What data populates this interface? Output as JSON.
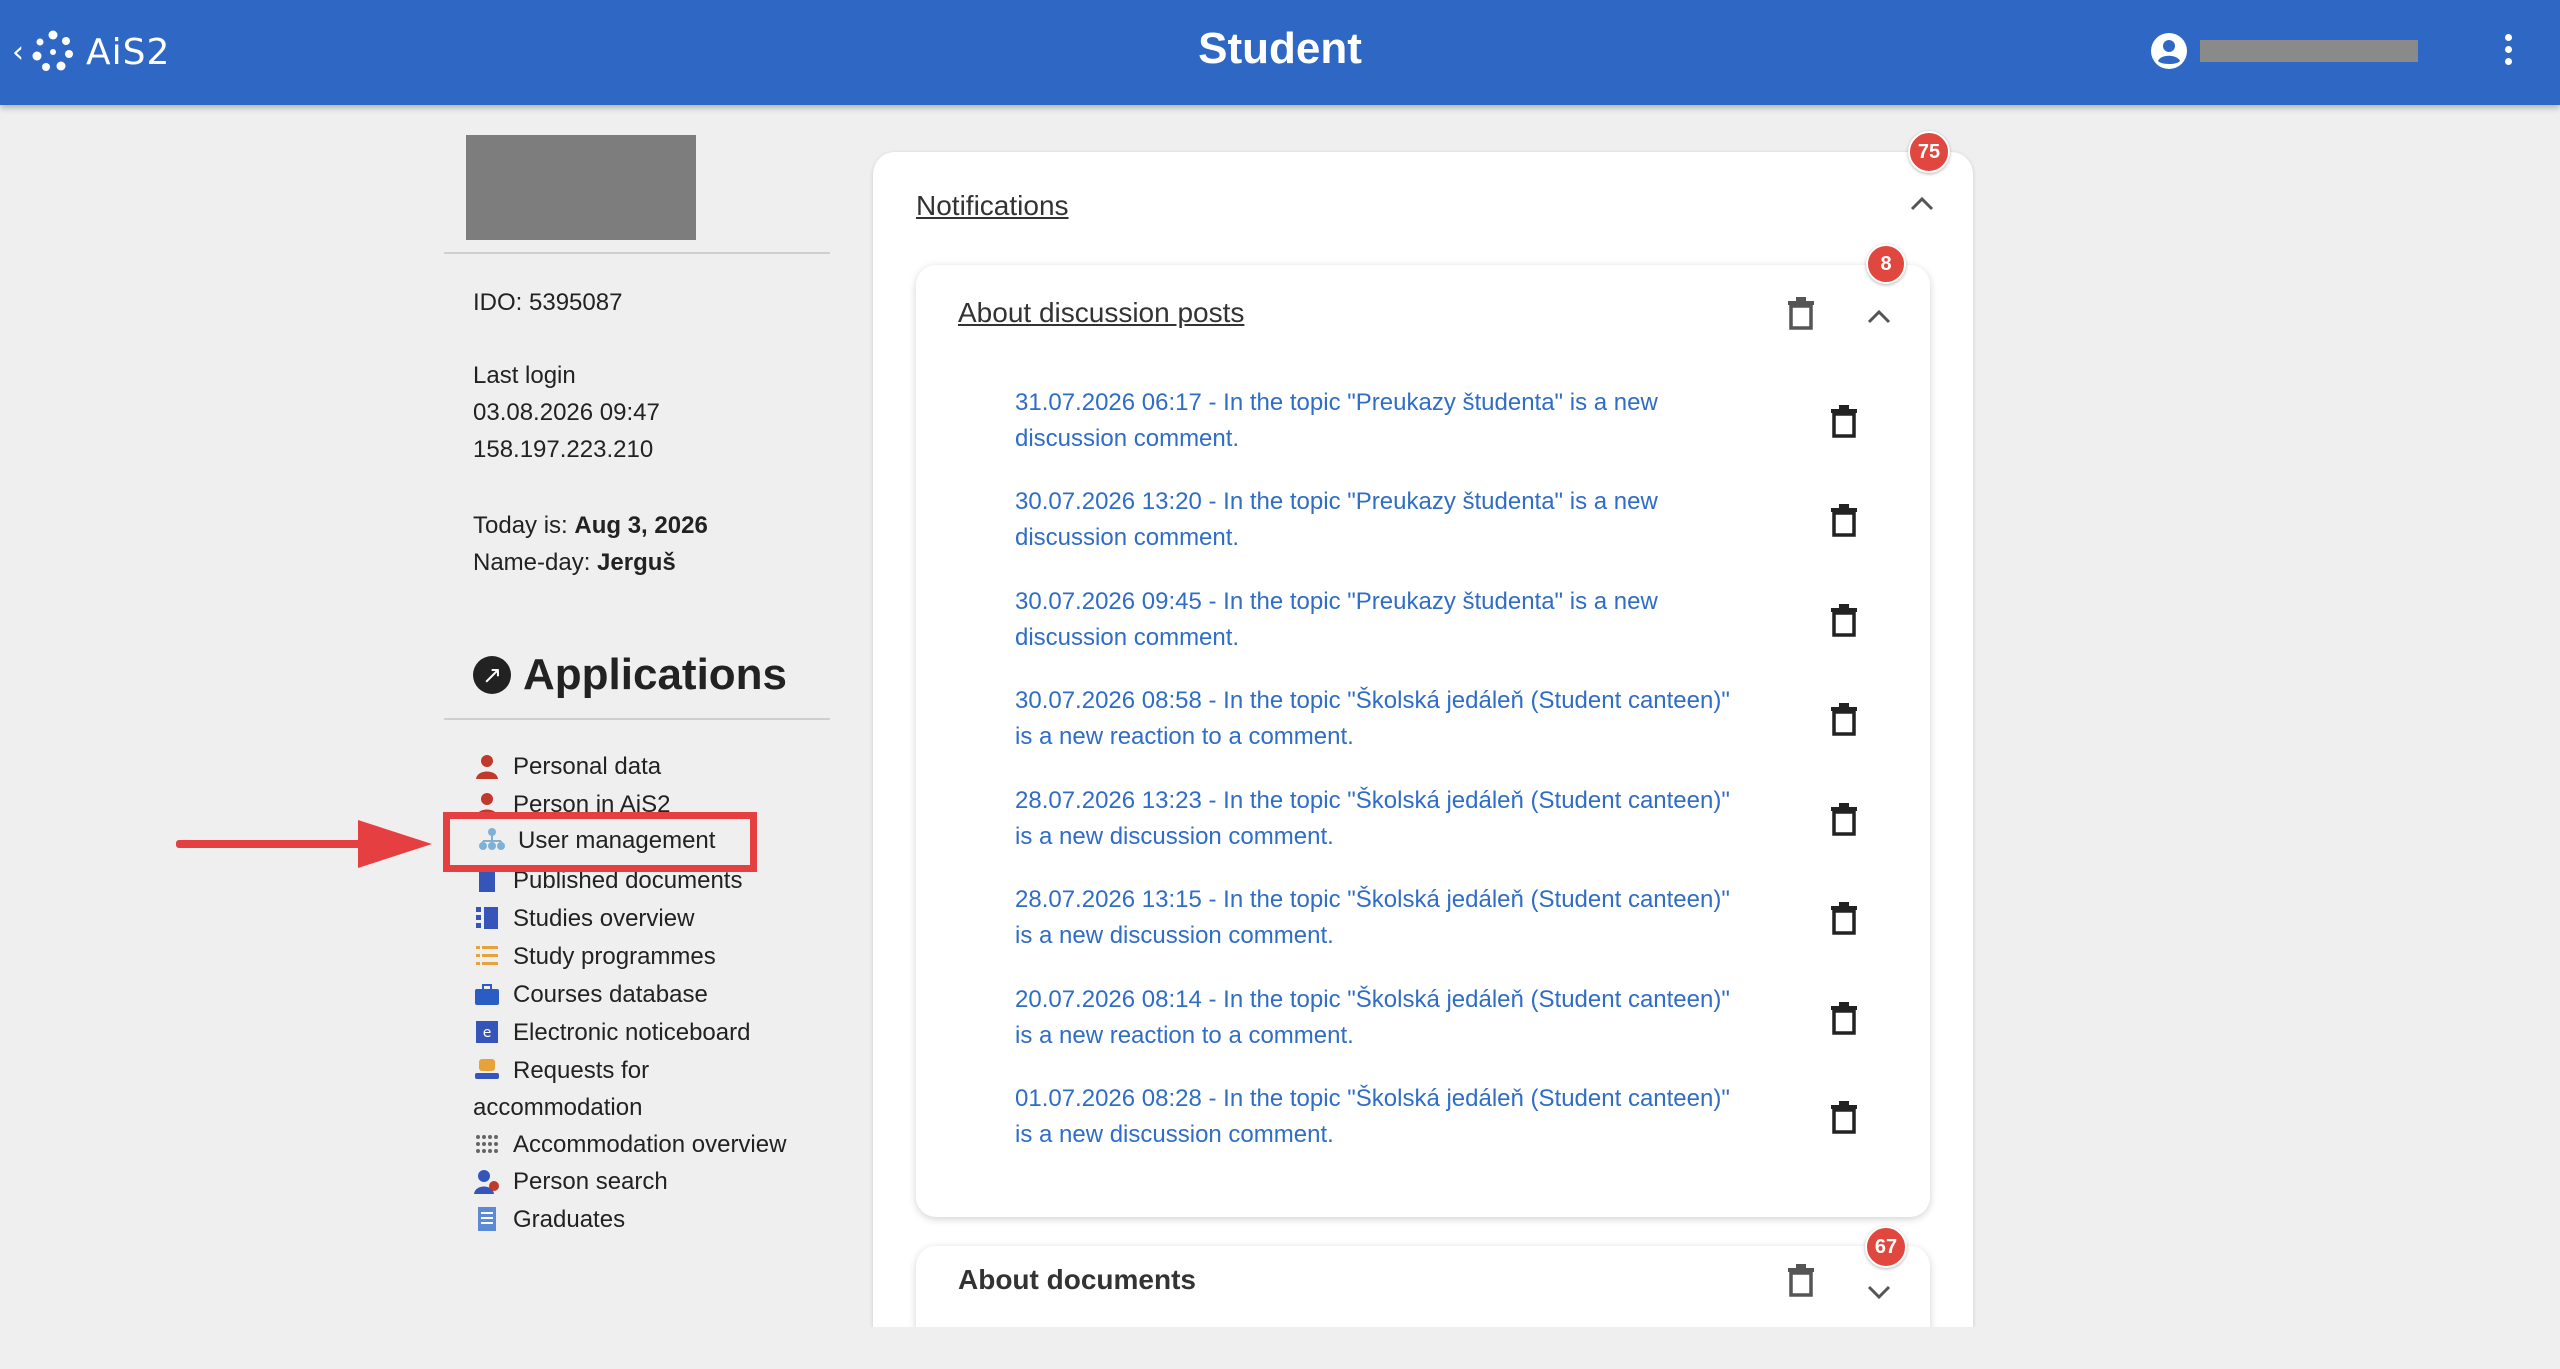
{
  "header": {
    "back_glyph": "‹",
    "brand": "AiS2",
    "title": "Student",
    "icons": [
      "user-account-icon",
      "more-vertical-icon"
    ]
  },
  "profile": {
    "ido": "IDO: 5395087",
    "last_login_label": "Last login",
    "last_login_time": "03.08.2026 09:47",
    "last_login_ip": "158.197.223.210",
    "today_label": "Today is: ",
    "today_value": "Aug 3, 2026",
    "nameday_label": "Name-day: ",
    "nameday_value": "Jerguš"
  },
  "applications": {
    "heading": "Applications",
    "items": [
      {
        "label": "Personal data",
        "icon": "person-icon"
      },
      {
        "label": "Person in AiS2",
        "icon": "person-icon"
      },
      {
        "label": "User management",
        "icon": "org-chart-icon"
      },
      {
        "label": "Published documents",
        "icon": "document-icon"
      },
      {
        "label": "Studies overview",
        "icon": "list-icon"
      },
      {
        "label": "Study programmes",
        "icon": "program-list-icon"
      },
      {
        "label": "Courses database",
        "icon": "briefcase-icon"
      },
      {
        "label": "Electronic noticeboard",
        "icon": "noticeboard-icon"
      },
      {
        "label": "Requests for accommodation",
        "icon": "accommodation-request-icon"
      },
      {
        "label": "Accommodation overview",
        "icon": "grid-dots-icon"
      },
      {
        "label": "Person search",
        "icon": "person-search-icon"
      },
      {
        "label": "Graduates",
        "icon": "certificate-icon"
      }
    ]
  },
  "notifications": {
    "title": "Notifications",
    "badge": "75",
    "groups": [
      {
        "title": "About discussion posts",
        "badge": "8",
        "items": [
          {
            "line1": "31.07.2026 06:17 - In the topic \"Preukazy študenta\" is a new",
            "line2": "discussion comment."
          },
          {
            "line1": "30.07.2026 13:20 - In the topic \"Preukazy študenta\" is a new",
            "line2": "discussion comment."
          },
          {
            "line1": "30.07.2026 09:45 - In the topic \"Preukazy študenta\" is a new",
            "line2": "discussion comment."
          },
          {
            "line1": "30.07.2026 08:58 - In the topic \"Školská jedáleň (Student canteen)\"",
            "line2": "is a new reaction to a comment."
          },
          {
            "line1": "28.07.2026 13:23 - In the topic \"Školská jedáleň (Student canteen)\"",
            "line2": "is a new discussion comment."
          },
          {
            "line1": "28.07.2026 13:15 - In the topic \"Školská jedáleň (Student canteen)\"",
            "line2": "is a new discussion comment."
          },
          {
            "line1": "20.07.2026 08:14 - In the topic \"Školská jedáleň (Student canteen)\"",
            "line2": "is a new reaction to a comment."
          },
          {
            "line1": "01.07.2026 08:28 - In the topic \"Školská jedáleň (Student canteen)\"",
            "line2": "is a new discussion comment."
          }
        ]
      },
      {
        "title": "About documents",
        "badge": "67"
      }
    ]
  },
  "colors": {
    "header_bg": "#2f68c4",
    "link": "#2f6dc6",
    "badge": "#e0473f",
    "highlight": "#e53f42"
  }
}
